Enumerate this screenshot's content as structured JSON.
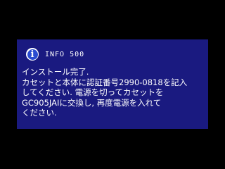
{
  "dialog": {
    "icon": "info-icon",
    "icon_glyph": "i",
    "title": "INFO 500",
    "lines": [
      "インストール完了.",
      "カセットと本体に認証番号2990-0818を記入",
      "してください. 電源を切ってカセットを",
      "GC905JAIに交換し, 再度電源を入れて",
      "ください."
    ],
    "colors": {
      "background": "#000000",
      "dialog": "#1a1a80",
      "icon": "#2a4cd0",
      "text": "#ffffff"
    }
  }
}
